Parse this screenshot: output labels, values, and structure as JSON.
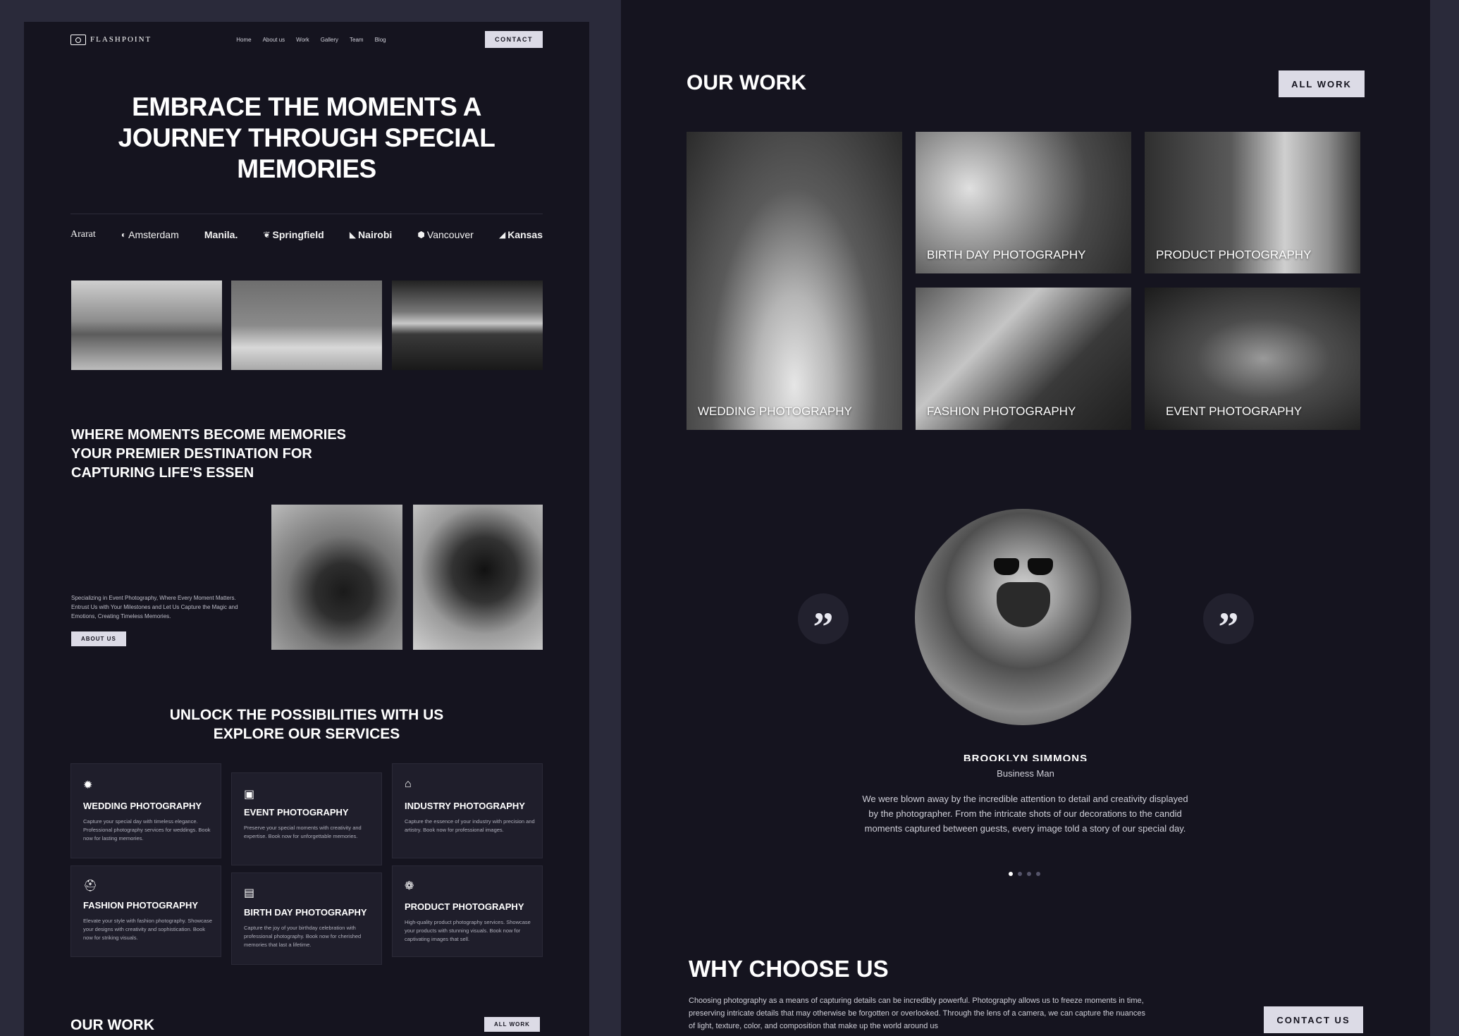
{
  "nav": {
    "logo_text": "FLASHPOINT",
    "menu": [
      "Home",
      "About us",
      "Work",
      "Gallery",
      "Team",
      "Blog"
    ],
    "contact_label": "CONTACT"
  },
  "hero": {
    "title_line1": "EMBRACE THE MOMENTS A",
    "title_line2": "JOURNEY THROUGH SPECIAL",
    "title_line3": "MEMORIES"
  },
  "brands": [
    "Ararat",
    "Amsterdam",
    "Manila.",
    "Springfield",
    "Nairobi",
    "Vancouver",
    "Kansas"
  ],
  "about": {
    "title_line1": "WHERE MOMENTS BECOME MEMORIES",
    "title_line2": "YOUR PREMIER DESTINATION FOR",
    "title_line3": "CAPTURING LIFE'S ESSEN",
    "text": "Specializing in Event Photography, Where Every Moment Matters. Entrust Us with Your Milestones and Let Us Capture the Magic and Emotions, Creating Timeless Memories.",
    "button_label": "ABOUT US"
  },
  "services": {
    "title_line1": "UNLOCK THE POSSIBILITIES WITH US",
    "title_line2": "EXPLORE OUR SERVICES",
    "items": [
      {
        "title": "WEDDING PHOTOGRAPHY",
        "text": "Capture your special day with timeless elegance. Professional photography services for weddings. Book now for lasting memories."
      },
      {
        "title": "EVENT PHOTOGRAPHY",
        "text": "Preserve your special moments with creativity and expertise. Book now for unforgettable memories."
      },
      {
        "title": "INDUSTRY PHOTOGRAPHY",
        "text": "Capture the essence of your industry with precision and artistry. Book now for professional images."
      },
      {
        "title": "FASHION PHOTOGRAPHY",
        "text": "Elevate your style with fashion photography. Showcase your designs with creativity and sophistication. Book now for striking visuals."
      },
      {
        "title": "BIRTH DAY PHOTOGRAPHY",
        "text": "Capture the joy of your birthday celebration with professional photography. Book now for cherished memories that last a lifetime."
      },
      {
        "title": "PRODUCT PHOTOGRAPHY",
        "text": "High-quality product photography services. Showcase your products with stunning visuals. Book now for captivating images that sell."
      }
    ]
  },
  "our_work_left": {
    "title": "OUR WORK",
    "button_label": "ALL WORK"
  },
  "our_work": {
    "title": "OUR WORK",
    "button_label": "ALL WORK",
    "items": [
      "WEDDING PHOTOGRAPHY",
      "BIRTH DAY PHOTOGRAPHY",
      "PRODUCT PHOTOGRAPHY",
      "FASHION PHOTOGRAPHY",
      "EVENT PHOTOGRAPHY"
    ]
  },
  "testimonial": {
    "quote_glyph": "”",
    "name": "BROOKLYN SIMMONS",
    "role": "Business Man",
    "text": "We were blown away by the incredible attention to detail and creativity displayed by the photographer. From the intricate shots of our decorations to the candid moments captured between guests, every image told a story of our special day.",
    "dots_total": 4,
    "dots_active": 1
  },
  "why": {
    "title": "WHY CHOOSE US",
    "text": "Choosing photography as a means of capturing details can be incredibly powerful. Photography allows us to freeze moments in time, preserving intricate details that may otherwise be forgotten or overlooked. Through the lens of a camera, we can capture the nuances of light, texture, color, and composition that make up the world around us",
    "button_label": "CONTACT US"
  },
  "icons": {
    "brand_marks": [
      "",
      "toggle-icon",
      "",
      "leaf-icon",
      "n-logo-icon",
      "hexagon-icon",
      "k-logo-icon"
    ],
    "service_icons": [
      "gear-icon",
      "calendar-icon",
      "factory-icon",
      "hanger-icon",
      "gift-icon",
      "box-icon"
    ]
  },
  "colors": {
    "background": "#2a2a3a",
    "panel": "#15141f",
    "card": "#1f1e2b",
    "button": "#dcdbe6",
    "text": "#ffffff"
  }
}
